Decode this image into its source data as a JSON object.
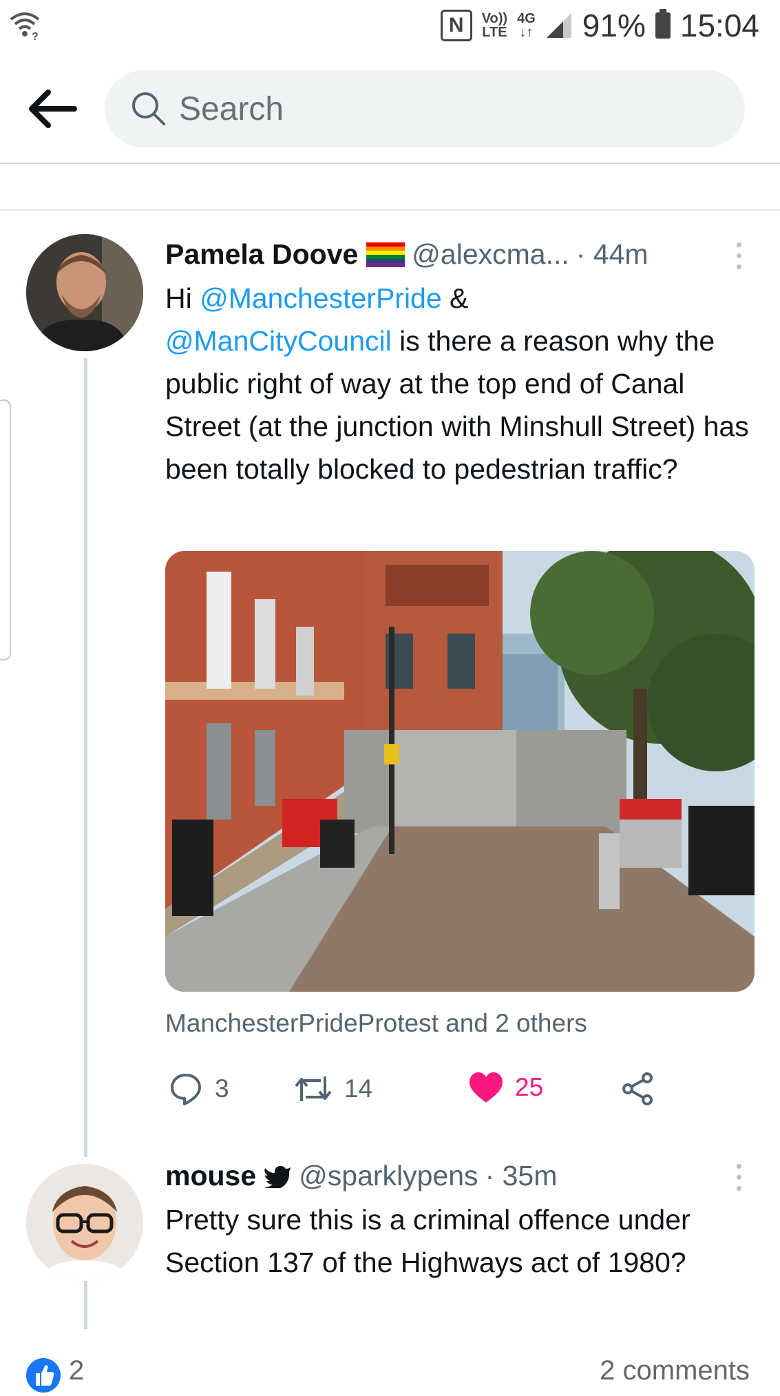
{
  "status_bar": {
    "nfc": "N",
    "volte_top": "Vo))",
    "volte_bottom": "LTE",
    "network": "4G",
    "network_arrows": "↓↑",
    "battery": "91%",
    "time": "15:04"
  },
  "header": {
    "search_placeholder": "Search",
    "cut_off_text": "· · · · ·"
  },
  "tweets": [
    {
      "name": "Pamela Doove",
      "badge": "rainbow-flag",
      "handle": "@alexcma...",
      "time": "· 44m",
      "text_prefix": "Hi ",
      "mention1": "@ManchesterPride",
      "text_mid": " &",
      "mention2": "@ManCityCouncil",
      "text_rest": " is there a reason why the public right of way at the top end of Canal Street (at the junction with Minshull Street) has been totally blocked to pedestrian traffic?",
      "tagged": "ManchesterPrideProtest and 2 others",
      "replies": "3",
      "retweets": "14",
      "likes": "25"
    },
    {
      "name": "mouse",
      "badge": "bird-icon",
      "handle": "@sparklypens",
      "time": "· 35m",
      "text": "Pretty sure this is a criminal offence under Section 137 of the Highways act of 1980?"
    }
  ],
  "footer": {
    "reactions_count": "2",
    "comments_label": "2 comments"
  },
  "colors": {
    "accent": "#1d9bf0",
    "like": "#f91880",
    "facebook_blue": "#1877f2"
  }
}
